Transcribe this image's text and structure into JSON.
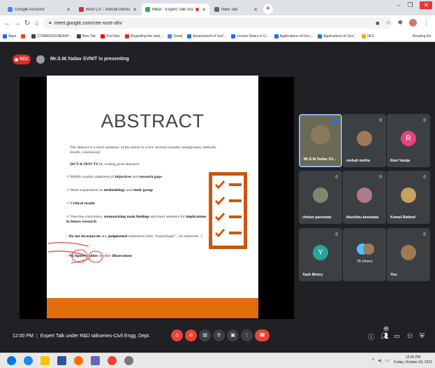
{
  "browser": {
    "tabs": [
      {
        "label": "Google Account",
        "fav_color": "#4285f4"
      },
      {
        "label": "Brief CV - mehali.mehta@scetsur...",
        "fav_color": "#d93025"
      },
      {
        "label": "Meet - Expert Talk under R&...",
        "fav_color": "#34a853"
      },
      {
        "label": "New Tab",
        "fav_color": "#5f6368"
      }
    ],
    "new_tab": "+",
    "window_controls": {
      "minimize": "–",
      "maximize": "❐",
      "close": "✕"
    },
    "url": "meet.google.com/cee-xvze-ahv",
    "bookmarks": [
      {
        "label": "Apps",
        "color": "#1a73e8"
      },
      {
        "label": "",
        "color": "#ea4335"
      },
      {
        "label": "COMMISSIONERAT...",
        "color": "#444444"
      },
      {
        "label": "New Tab",
        "color": "#444444"
      },
      {
        "label": "YouTube",
        "color": "#ff0000"
      },
      {
        "label": "Regarding the load...",
        "color": "#d93025"
      },
      {
        "label": "Gmail",
        "color": "#4285f4"
      },
      {
        "label": "Assessment of Surf...",
        "color": "#1a73e8"
      },
      {
        "label": "Lecture Notes in Ci...",
        "color": "#1a73e8"
      },
      {
        "label": "Applications of Geo...",
        "color": "#1a73e8"
      },
      {
        "label": "Applications of Geo...",
        "color": "#1a73e8"
      },
      {
        "label": "UES",
        "color": "#f9ab00"
      }
    ],
    "reading_list": "Reading list"
  },
  "meet": {
    "rec_label": "REC",
    "presenting_text": "Mr.S.M.Yadav SVNIT is presenting",
    "slide": {
      "title": "ABSTRACT",
      "intro": "The abstract is a short summary of the article in a few sections (usually background, methods, results, conclusion)",
      "heading": "DO'S & DON'TS",
      "heading_suffix": " for writing good abstracts",
      "b1_pre": "Briefly explain statement of ",
      "b1_bold1": "objectives",
      "b1_mid": " and ",
      "b1_bold2": "research gaps",
      "b1_post": ".",
      "b2_pre": "Short explanation on ",
      "b2_bold1": "methodology",
      "b2_mid": " and ",
      "b2_bold2": "study group",
      "b3_bold": "Critical results",
      "b4_pre": "One-line conclusion, ",
      "b4_bold1": "summarizing main findings",
      "b4_mid": " and short sentence for ",
      "b4_bold2": "implications in future research.",
      "b5_bold1": "Do not incorporate",
      "b5_mid": " any ",
      "b5_bold2": "judgmental",
      "b5_post": " statements (like \"Surprisingly\", we observed...)",
      "b6_bold1": "No figures",
      "b6_mid": ", ",
      "b6_bold2": "tables",
      "b6_mid2": " or other ",
      "b6_bold3": "illustrations",
      "accent": "#c55a11",
      "footer_color": "#e36c0a"
    },
    "participants": [
      {
        "name": "Mr.S.M.Yadav SV...",
        "initial": "",
        "color": "#6b6a55",
        "active": true
      },
      {
        "name": "mehali mehta",
        "initial": "",
        "color": "#a0785a",
        "active": false
      },
      {
        "name": "Ravi Vamja",
        "initial": "R",
        "color": "#ec407a",
        "active": false
      },
      {
        "name": "chetan parsewar",
        "initial": "",
        "color": "#7a8a6a",
        "active": false
      },
      {
        "name": "khushbu berawala",
        "initial": "",
        "color": "#b07a8a",
        "active": false
      },
      {
        "name": "Komal Rathod",
        "initial": "",
        "color": "#c8a060",
        "active": false
      },
      {
        "name": "Yash Mistry",
        "initial": "Y",
        "color": "#26a69a",
        "active": false
      },
      {
        "name": "",
        "initial": "",
        "color": "",
        "active": false,
        "others": "78 others"
      },
      {
        "name": "You",
        "initial": "",
        "color": "#a07a50",
        "active": false
      }
    ],
    "bottom": {
      "time": "12:00 PM",
      "meeting_title": "Expert Talk under R&D talkseries-Civil Engg. Dept.",
      "people_count": "87"
    }
  },
  "taskbar": {
    "clock_time": "12:00 PM",
    "clock_date": "Friday, October 29, 2021"
  }
}
